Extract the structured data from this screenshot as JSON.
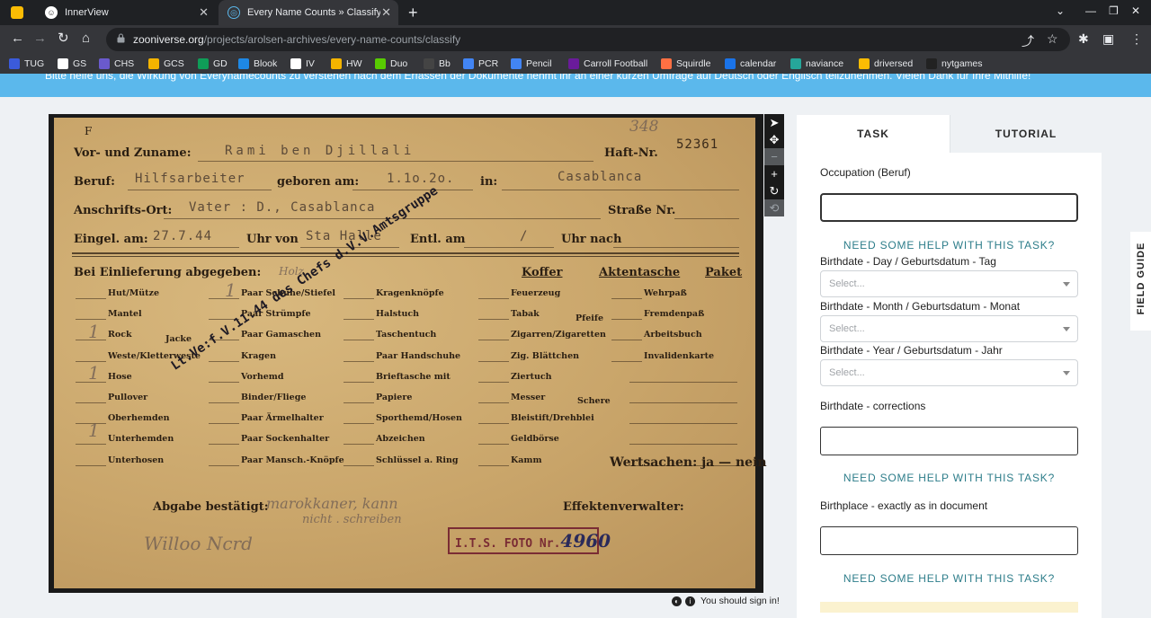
{
  "browser": {
    "tabs": [
      {
        "title": "InnerView",
        "active": false
      },
      {
        "title": "Every Name Counts » Classify -",
        "active": true
      }
    ],
    "url_host": "zooniverse.org",
    "url_path": "/projects/arolsen-archives/every-name-counts/classify",
    "bookmarks": [
      {
        "label": "TUG",
        "color": "#3b5bdb"
      },
      {
        "label": "GS",
        "color": "#ffffff"
      },
      {
        "label": "CHS",
        "color": "#6a5acd"
      },
      {
        "label": "GCS",
        "color": "#f4b400"
      },
      {
        "label": "GD",
        "color": "#0f9d58"
      },
      {
        "label": "Blook",
        "color": "#1e88e5"
      },
      {
        "label": "IV",
        "color": "#ffffff"
      },
      {
        "label": "HW",
        "color": "#f4b400"
      },
      {
        "label": "Duo",
        "color": "#58cc02"
      },
      {
        "label": "Bb",
        "color": "#444444"
      },
      {
        "label": "PCR",
        "color": "#4285f4"
      },
      {
        "label": "Pencil",
        "color": "#4285f4"
      },
      {
        "label": "Carroll Football",
        "color": "#6a1b9a"
      },
      {
        "label": "Squirdle",
        "color": "#ff7043"
      },
      {
        "label": "calendar",
        "color": "#1a73e8"
      },
      {
        "label": "naviance",
        "color": "#26a69a"
      },
      {
        "label": "driversed",
        "color": "#fbbc04"
      },
      {
        "label": "nytgames",
        "color": "#222222"
      }
    ]
  },
  "banner": {
    "text": "Bitte helfe uns, die Wirkung von Everynamecounts zu verstehen nach dem Erfassen der Dokumente nehmt ihr an einer kurzen Umfrage auf Deutsch oder Englisch teilzunehmen. Vielen Dank für Ihre Mithilfe!"
  },
  "document": {
    "corner_letter": "F",
    "handwritten_number": "348",
    "labels": {
      "name": "Vor- und Zuname:",
      "haft_nr": "Haft-Nr.",
      "beruf": "Beruf:",
      "geboren_am": "geboren am:",
      "in": "in:",
      "anschrift": "Anschrifts-Ort:",
      "strasse": "Straße Nr.",
      "eingel": "Eingel. am:",
      "uhr_von": "Uhr von",
      "entl": "Entl. am",
      "uhr_nach": "Uhr nach",
      "bei_einlieferung": "Bei Einlieferung abgegeben:",
      "koffer": "Koffer",
      "aktentasche": "Aktentasche",
      "paket": "Paket",
      "wertsachen": "Wertsachen: ja — nein",
      "abgabe": "Abgabe bestätigt:",
      "effekten": "Effektenverwalter:"
    },
    "typed": {
      "name": "Rami ben Djillali",
      "haft_nr": "52361",
      "beruf": "Hilfsarbeiter",
      "geboren_am": "1.1o.2o.",
      "in": "Casablanca",
      "anschrift": "Vater : D., Casablanca",
      "eingel": "27.7.44",
      "uhr_von": "Sta Halle",
      "entl": "/"
    },
    "items_col1": [
      "Hut/Mütze",
      "Mantel",
      "Rock",
      "Weste/Kletterweste",
      "Hose",
      "Pullover",
      "Oberhemden",
      "Unterhemden",
      "Unterhosen"
    ],
    "items_col2": [
      "Paar Schuhe/Stiefel",
      "Paar Strümpfe",
      "Paar Gamaschen",
      "Kragen",
      "Vorhemd",
      "Binder/Fliege",
      "Paar Ärmelhalter",
      "Paar Sockenhalter",
      "Paar Mansch.-Knöpfe"
    ],
    "items_col3": [
      "Kragenknöpfe",
      "Halstuch",
      "Taschentuch",
      "Paar Handschuhe",
      "Brieftasche mit",
      "Papiere",
      "Sporthemd/Hosen",
      "Abzeichen",
      "Schlüssel a. Ring"
    ],
    "items_col4": [
      "Feuerzeug",
      "Tabak",
      "Zigarren/Zigaretten",
      "Zig. Blättchen",
      "Ziertuch",
      "Messer",
      "Bleistift/Drehblei",
      "Geldbörse",
      "Kamm"
    ],
    "items_col5": [
      "Wehrpaß",
      "Fremdenpaß",
      "Arbeitsbuch",
      "Invalidenkarte"
    ],
    "extra_pfeife": "Pfeife",
    "extra_schere": "Schere",
    "extra_jacke": "Jacke",
    "extra_holz": "Holz",
    "stamp_diagonal": "Lt.Ve:f.V.11.44 des Chefs d.V.V.Amtsgruppe",
    "stamp_box": "I.T.S. FOTO Nr.",
    "stamp_number": "4960",
    "handwriting_abgabe": "marokkaner, kann",
    "handwriting_abgabe2": "nicht . schreiben",
    "signature": "Willoo Ncrd"
  },
  "viewer_tools": [
    "pointer",
    "move",
    "zoom-out",
    "zoom-in",
    "rotate",
    "reset"
  ],
  "signin": {
    "text": "You should sign in!"
  },
  "panel": {
    "tab_task": "TASK",
    "tab_tutorial": "TUTORIAL",
    "occupation_label": "Occupation (Beruf)",
    "help_text": "NEED SOME HELP WITH THIS TASK?",
    "birth_day_label": "Birthdate - Day / Geburtsdatum - Tag",
    "birth_month_label": "Birthdate - Month / Geburtsdatum - Monat",
    "birth_year_label": "Birthdate - Year / Geburtsdatum - Jahr",
    "select_placeholder": "Select...",
    "corrections_label": "Birthdate - corrections",
    "birthplace_label": "Birthplace - exactly as in document",
    "field_guide": "FIELD GUIDE"
  }
}
